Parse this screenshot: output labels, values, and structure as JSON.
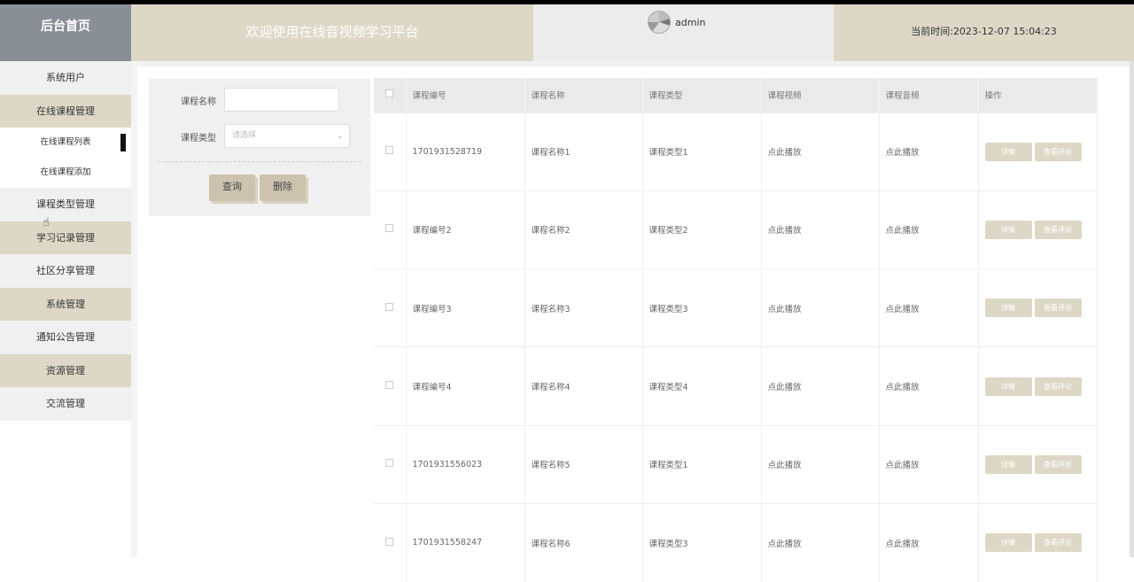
{
  "header": {
    "logo": "后台首页",
    "welcome": "欢迎使用在线音视频学习平台",
    "username": "admin",
    "time_label": "当前时间:",
    "time_value": "2023-12-07 15:04:23"
  },
  "sidebar": {
    "items": [
      {
        "label": "系统用户"
      },
      {
        "label": "在线课程管理"
      },
      {
        "label": "在线课程列表"
      },
      {
        "label": "在线课程添加"
      },
      {
        "label": "课程类型管理"
      },
      {
        "label": "学习记录管理"
      },
      {
        "label": "社区分享管理"
      },
      {
        "label": "系统管理"
      },
      {
        "label": "通知公告管理"
      },
      {
        "label": "资源管理"
      },
      {
        "label": "交流管理"
      }
    ]
  },
  "search": {
    "name_label": "课程名称",
    "name_value": "",
    "type_label": "课程类型",
    "type_placeholder": "请选择",
    "query_button": "查询",
    "delete_button": "删除"
  },
  "table": {
    "headers": [
      "课程编号",
      "课程名称",
      "课程类型",
      "课程视频",
      "课程音频",
      "操作"
    ],
    "rows": [
      {
        "code": "1701931528719",
        "name": "课程名称1",
        "type": "课程类型1",
        "video": "点此播放",
        "audio": "点此播放"
      },
      {
        "code": "课程编号2",
        "name": "课程名称2",
        "type": "课程类型2",
        "video": "点此播放",
        "audio": "点此播放"
      },
      {
        "code": "课程编号3",
        "name": "课程名称3",
        "type": "课程类型3",
        "video": "点此播放",
        "audio": "点此播放"
      },
      {
        "code": "课程编号4",
        "name": "课程名称4",
        "type": "课程类型4",
        "video": "点此播放",
        "audio": "点此播放"
      },
      {
        "code": "1701931556023",
        "name": "课程名称5",
        "type": "课程类型1",
        "video": "点此播放",
        "audio": "点此播放"
      },
      {
        "code": "1701931558247",
        "name": "课程名称6",
        "type": "课程类型3",
        "video": "点此播放",
        "audio": "点此播放"
      }
    ],
    "detail_label": "详情",
    "review_label": "查看评论"
  }
}
